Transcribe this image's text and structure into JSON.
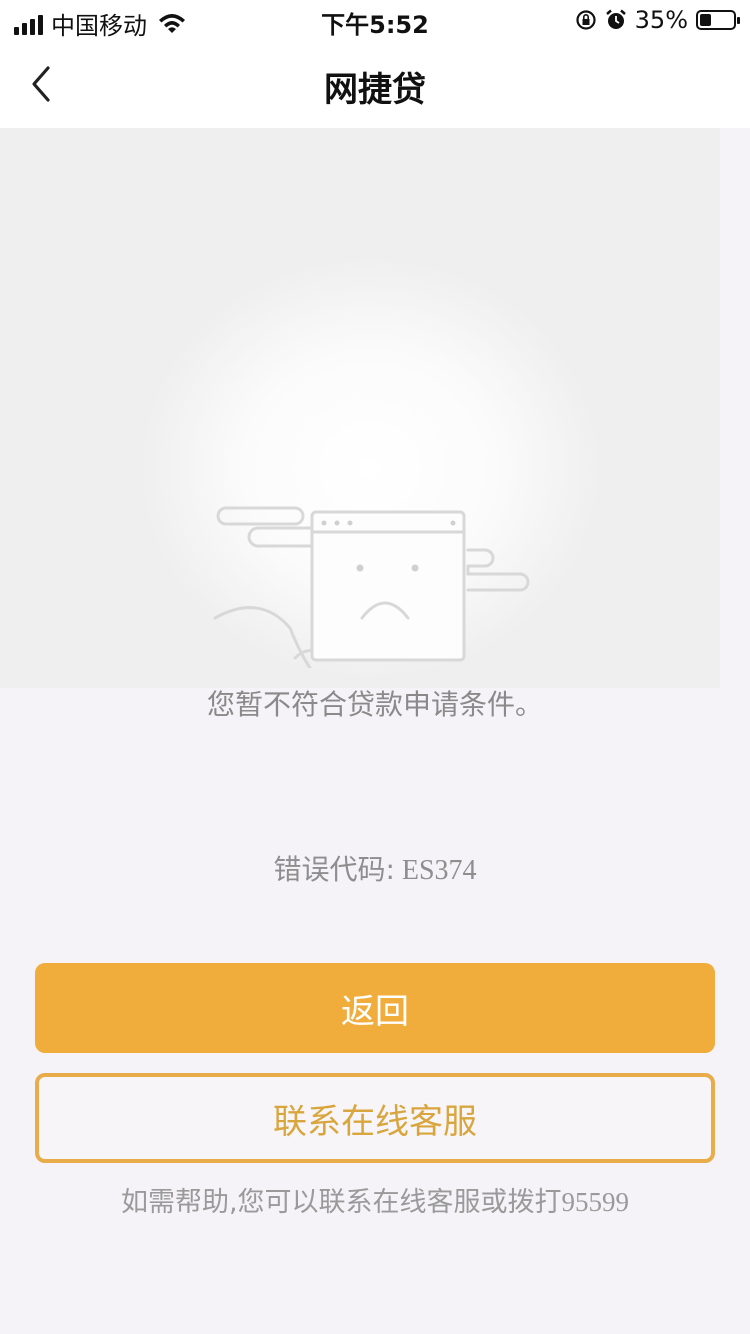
{
  "status_bar": {
    "carrier": "中国移动",
    "time": "下午5:52",
    "battery_percent": "35%",
    "battery_level": 0.35,
    "icons": [
      "signal-icon",
      "wifi-icon",
      "rotation-lock-icon",
      "alarm-icon",
      "battery-icon"
    ]
  },
  "nav": {
    "title": "网捷贷",
    "back_icon": "chevron-left-icon"
  },
  "illustration": {
    "icon": "sad-browser-window-icon"
  },
  "message": "您暂不符合贷款申请条件。",
  "error": {
    "label": "错误代码:",
    "code": "ES374"
  },
  "buttons": {
    "back_label": "返回",
    "contact_label": "联系在线客服"
  },
  "help": {
    "text": "如需帮助,您可以联系在线客服或拨打",
    "phone": "95599"
  },
  "colors": {
    "primary": "#f0ad3c",
    "secondary_border": "#e8ac4a",
    "background": "#f5f3f7"
  }
}
